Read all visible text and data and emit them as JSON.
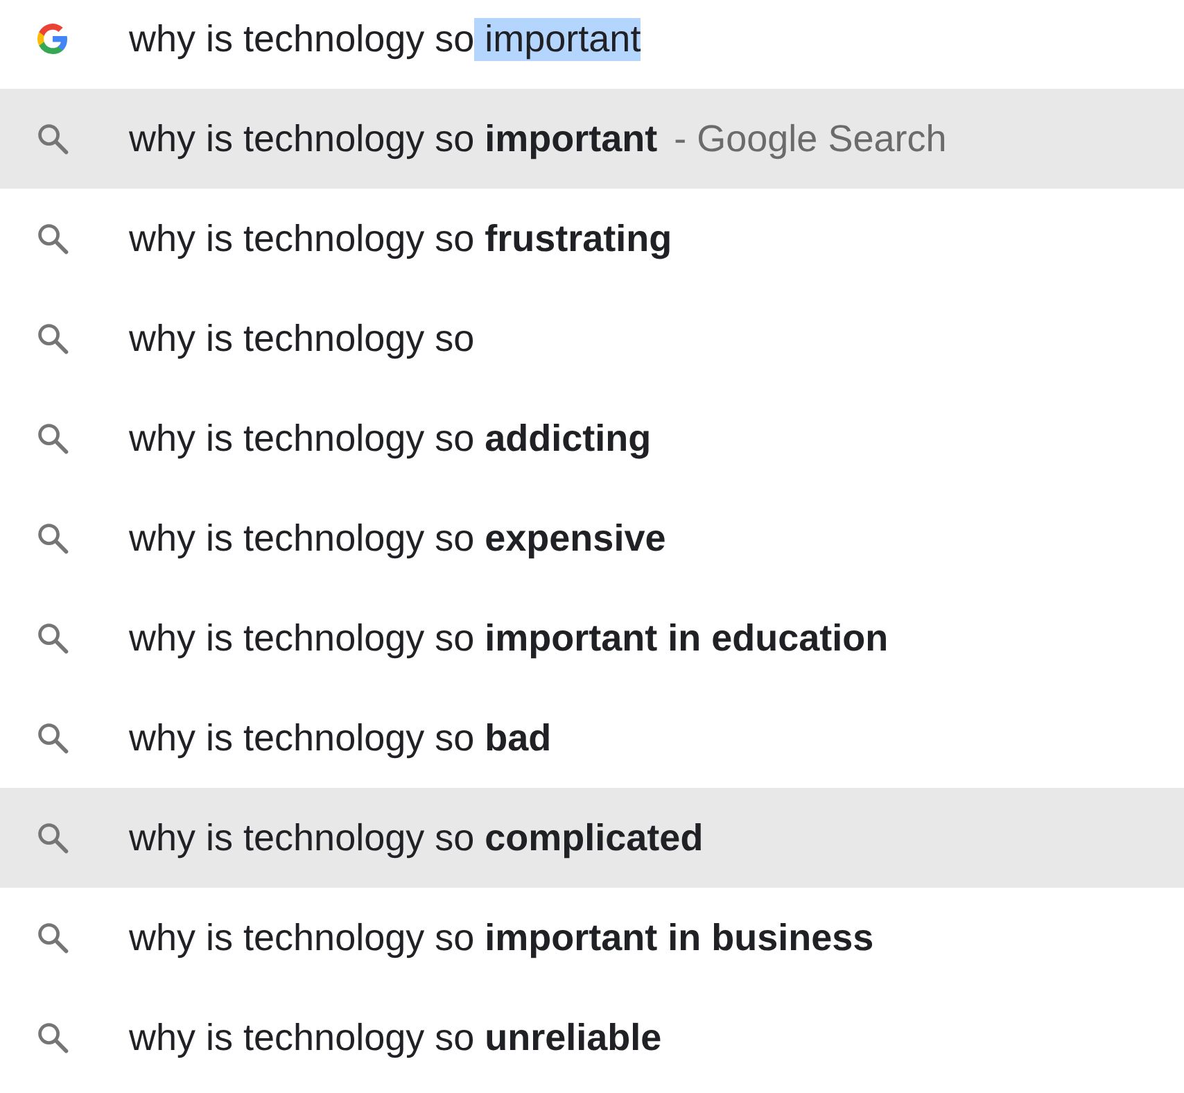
{
  "search_box": {
    "value": "why is technology so",
    "selected_text": " important"
  },
  "suggestions": [
    {
      "text": "why is technology so **important**",
      "source": "- Google Search",
      "selected": true
    },
    {
      "text": "why is technology so **frustrating**",
      "selected": false
    },
    {
      "text": "why is technology so",
      "selected": false
    },
    {
      "text": "why is technology so **addicting**",
      "selected": false
    },
    {
      "text": "why is technology so **expensive**",
      "selected": false
    },
    {
      "text": "why is technology so **important in education**",
      "selected": false
    },
    {
      "text": "why is technology so **bad**",
      "selected": false
    },
    {
      "text": "why is technology so **complicated**",
      "selected": true
    },
    {
      "text": "why is technology so **important in business**",
      "selected": false
    },
    {
      "text": "why is technology so **unreliable**",
      "selected": false
    }
  ]
}
